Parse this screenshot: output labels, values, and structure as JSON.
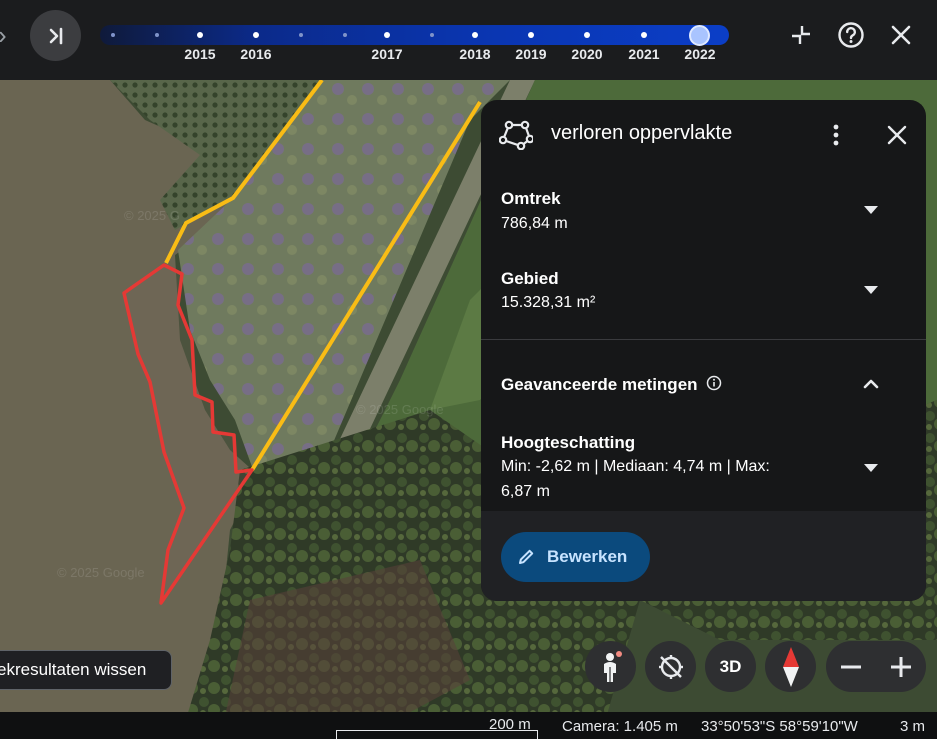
{
  "timeline": {
    "years": [
      "2015",
      "2016",
      "2017",
      "2018",
      "2019",
      "2020",
      "2021",
      "2022"
    ],
    "selected": "2022"
  },
  "panel": {
    "title": "verloren oppervlakte",
    "perimeter": {
      "label": "Omtrek",
      "value": "786,84 m"
    },
    "area": {
      "label": "Gebied",
      "value": "15.328,31 m²"
    },
    "advanced": {
      "label": "Geavanceerde metingen"
    },
    "height": {
      "label": "Hoogteschatting",
      "line1": "Min: -2,62 m | Mediaan: 4,74 m | Max:",
      "line2": "6,87 m"
    },
    "edit_label": "Bewerken"
  },
  "map": {
    "clear_results_label": "ekresultaten wissen",
    "view_3d_label": "3D",
    "watermarks": [
      "© 2025 G",
      "© 2025 Google",
      "© 2025 Google"
    ]
  },
  "status": {
    "scale": "200 m",
    "camera": "Camera: 1.405 m",
    "coords": "33°50'53\"S 58°59'10\"W",
    "elevation": "3 m"
  },
  "colors": {
    "polygon_red": "#e53935",
    "path_yellow": "#f9bc15",
    "accent_blue": "#0b4a7d"
  }
}
